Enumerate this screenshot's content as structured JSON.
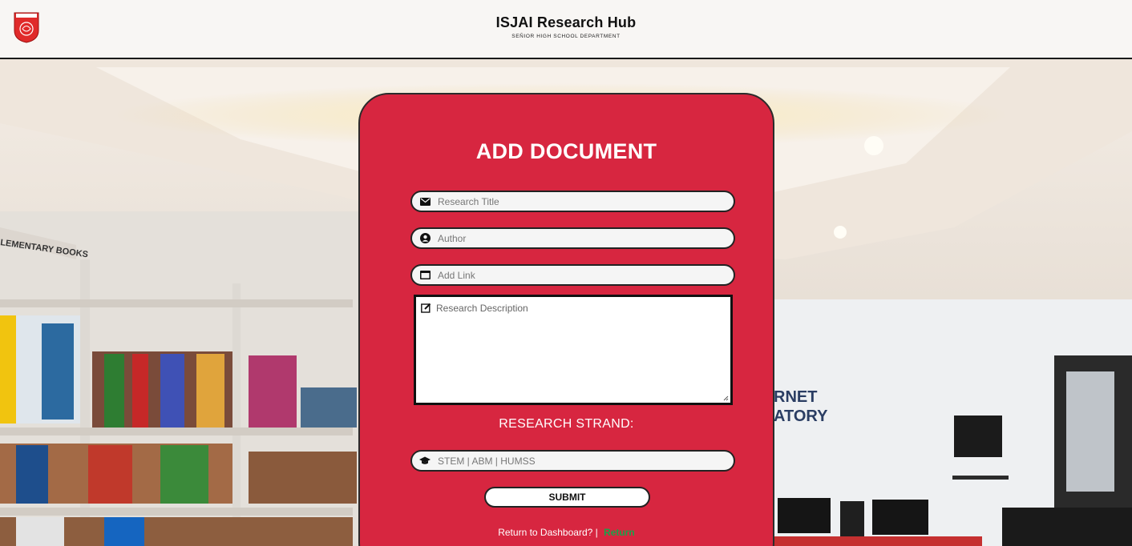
{
  "header": {
    "title": "ISJAI Research Hub",
    "subtitle": "SEÑIOR HIGH SCHOOL DEPARTMENT"
  },
  "form": {
    "title": "ADD DOCUMENT",
    "fields": {
      "research_title": {
        "placeholder": "Research Title",
        "value": "",
        "icon": "envelope-icon"
      },
      "author": {
        "placeholder": "Author",
        "value": "",
        "icon": "user-circle-icon"
      },
      "link": {
        "placeholder": "Add Link",
        "value": "",
        "icon": "card-icon"
      },
      "description": {
        "placeholder": "Research Description",
        "value": "",
        "icon": "edit-icon"
      },
      "strand": {
        "placeholder": "STEM | ABM | HUMSS",
        "value": "",
        "icon": "graduation-cap-icon"
      }
    },
    "strand_label": "RESEARCH STRAND:",
    "submit_label": "SUBMIT",
    "return_prompt": "Return to Dashboard? |",
    "return_link": "Return"
  },
  "colors": {
    "card_red": "#d72640",
    "header_bg": "#f8f6f4",
    "return_link_green": "#19a24a"
  }
}
